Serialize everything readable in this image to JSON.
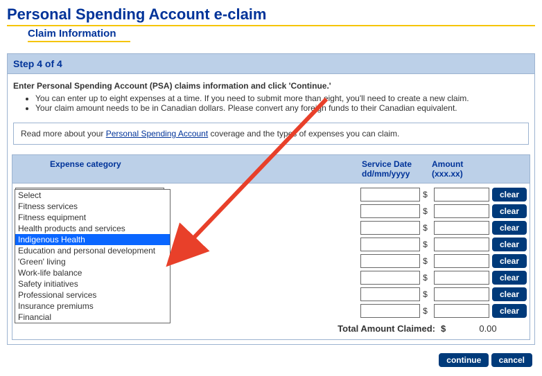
{
  "header": {
    "title": "Personal Spending Account e-claim",
    "subtitle": "Claim Information"
  },
  "step": {
    "label": "Step 4 of 4"
  },
  "instructions": {
    "title": "Enter Personal Spending Account (PSA) claims information and click 'Continue.'",
    "bullets": [
      "You can enter up to eight expenses at a time. If you need to submit more than eight, you'll need to create a new claim.",
      "Your claim amount needs to be in Canadian dollars. Please convert any foreign funds to their Canadian equivalent."
    ]
  },
  "info": {
    "pre": "Read more about your ",
    "link": "Personal Spending Account",
    "post": " coverage and the types of expenses you can claim."
  },
  "grid": {
    "headers": {
      "category": "Expense category",
      "date": "Service Date dd/mm/yyyy",
      "amount": "Amount (xxx.xx)"
    },
    "currency": "$",
    "select_current": "Select",
    "options": [
      "Select",
      "Fitness services",
      "Fitness equipment",
      "Health products and services",
      "Indigenous Health",
      "Education and personal development",
      "'Green' living",
      "Work-life balance",
      "Safety initiatives",
      "Professional services",
      "Insurance premiums",
      "Financial"
    ],
    "highlighted_option_index": 4,
    "clear_label": "clear",
    "row_count": 8,
    "total_label": "Total Amount Claimed:",
    "total_value": "0.00"
  },
  "actions": {
    "continue": "continue",
    "cancel": "cancel"
  }
}
